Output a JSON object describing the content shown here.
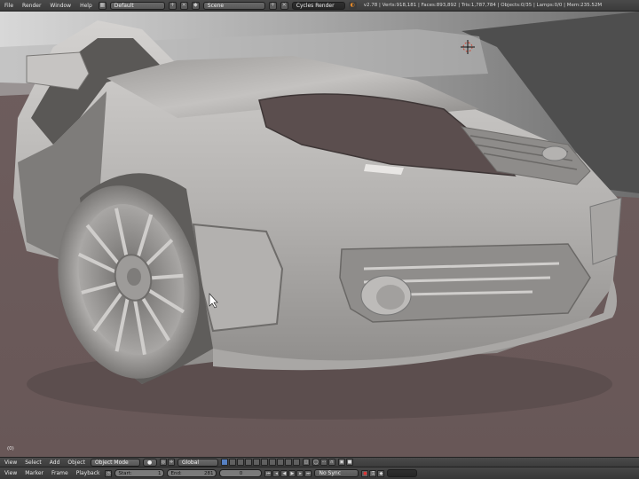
{
  "top_bar": {
    "menus": [
      "File",
      "Render",
      "Window",
      "Help"
    ],
    "layout_value": "Default",
    "scene_value": "Scene",
    "engine_value": "Cycles Render",
    "stats": "v2.78 | Verts:918,181 | Faces:893,892 | Tris:1,787,784 | Objects:0/35 | Lamps:0/0 | Mem:235.52M"
  },
  "viewport": {
    "frame_label": "(0)"
  },
  "view_header": {
    "menus": [
      "View",
      "Select",
      "Add",
      "Object"
    ],
    "mode_value": "Object Mode",
    "orientation_value": "Global"
  },
  "timeline": {
    "menus": [
      "View",
      "Marker",
      "Frame",
      "Playback"
    ],
    "start_label": "Start:",
    "start_value": "1",
    "end_label": "End:",
    "end_value": "281",
    "current_frame": "0",
    "sync_value": "No Sync"
  },
  "colors": {
    "header_bg": "#3f3f3f",
    "floor": "#6b5b5b",
    "backdrop": "#a8a8a8",
    "car_body": "#b9b7b5"
  }
}
